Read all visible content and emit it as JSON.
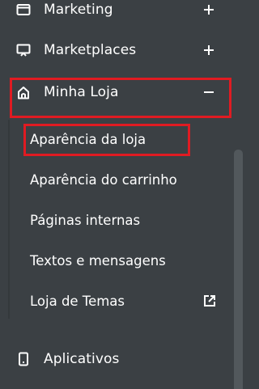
{
  "menu": {
    "marketing": {
      "label": "Marketing",
      "icon": "window-icon",
      "toggle": "+"
    },
    "marketplaces": {
      "label": "Marketplaces",
      "icon": "monitor-icon",
      "toggle": "+"
    },
    "minha_loja": {
      "label": "Minha Loja",
      "icon": "home-icon",
      "toggle": "−",
      "items": [
        {
          "label": "Aparência da loja"
        },
        {
          "label": "Aparência do carrinho"
        },
        {
          "label": "Páginas internas"
        },
        {
          "label": "Textos e mensagens"
        },
        {
          "label": "Loja de Temas",
          "icon": "external-link-icon"
        }
      ]
    },
    "aplicativos": {
      "label": "Aplicativos",
      "icon": "mobile-icon"
    }
  },
  "colors": {
    "background": "#3b4044",
    "text": "#ffffff",
    "highlight": "#e01b22",
    "scrollbar_thumb": "#52585c"
  }
}
